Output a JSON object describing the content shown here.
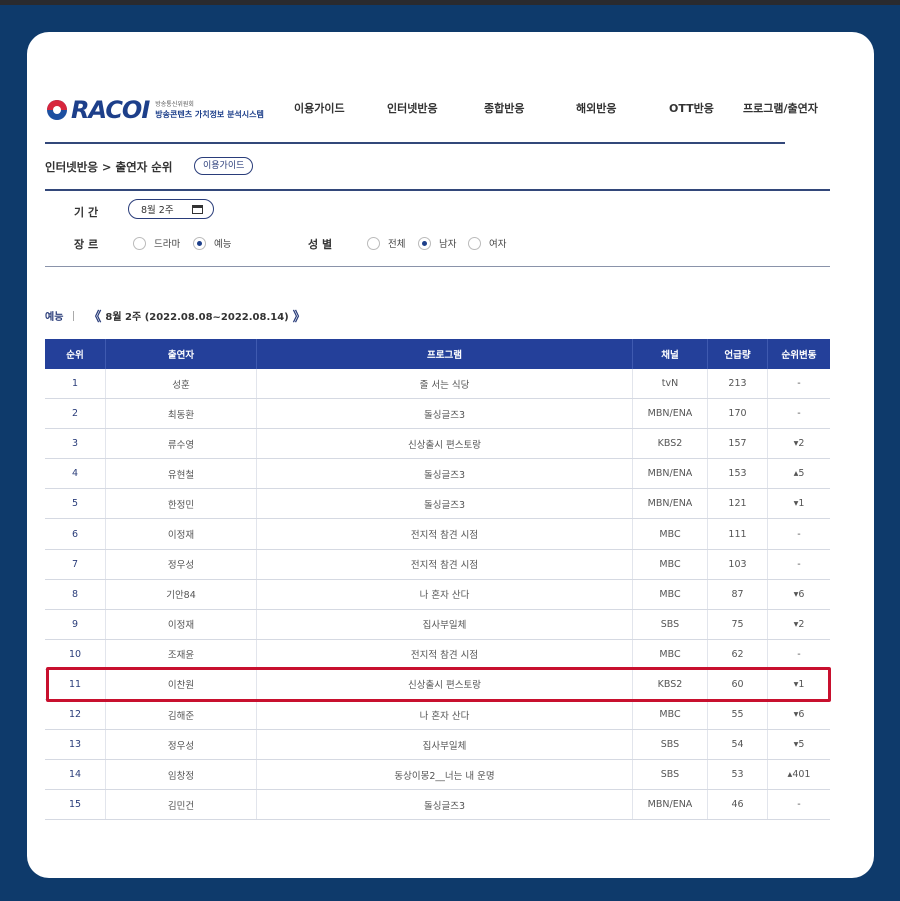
{
  "logo": {
    "word": "RACOI",
    "sub_top": "방송통신위원회",
    "sub_bottom": "방송콘텐츠 가치정보 분석시스템"
  },
  "nav": [
    "이용가이드",
    "인터넷반응",
    "종합반응",
    "해외반응",
    "OTT반응",
    "프로그램/출연자"
  ],
  "breadcrumb": "인터넷반응 > 출연자 순위",
  "guide_button": "이용가이드",
  "filters": {
    "period_label": "기 간",
    "period_value": "8월 2주",
    "genre_label": "장 르",
    "genre_options": [
      {
        "label": "드라마",
        "selected": false
      },
      {
        "label": "예능",
        "selected": true
      }
    ],
    "gender_label": "성 별",
    "gender_options": [
      {
        "label": "전체",
        "selected": false
      },
      {
        "label": "남자",
        "selected": true
      },
      {
        "label": "여자",
        "selected": false
      }
    ]
  },
  "week": {
    "category": "예능",
    "prev": "《",
    "label": "8월 2주 (2022.08.08~2022.08.14)",
    "next": "》"
  },
  "table": {
    "headers": [
      "순위",
      "출연자",
      "프로그램",
      "채널",
      "언급량",
      "순위변동"
    ],
    "rows": [
      [
        "1",
        "성훈",
        "줄 서는 식당",
        "tvN",
        "213",
        "-"
      ],
      [
        "2",
        "최동환",
        "돌싱글즈3",
        "MBN/ENA",
        "170",
        "-"
      ],
      [
        "3",
        "류수영",
        "신상출시 편스토랑",
        "KBS2",
        "157",
        "▾2"
      ],
      [
        "4",
        "유현철",
        "돌싱글즈3",
        "MBN/ENA",
        "153",
        "▴5"
      ],
      [
        "5",
        "한정민",
        "돌싱글즈3",
        "MBN/ENA",
        "121",
        "▾1"
      ],
      [
        "6",
        "이정재",
        "전지적 참견 시점",
        "MBC",
        "111",
        "-"
      ],
      [
        "7",
        "정우성",
        "전지적 참견 시점",
        "MBC",
        "103",
        "-"
      ],
      [
        "8",
        "기안84",
        "나 혼자 산다",
        "MBC",
        "87",
        "▾6"
      ],
      [
        "9",
        "이정재",
        "집사부일체",
        "SBS",
        "75",
        "▾2"
      ],
      [
        "10",
        "조재윤",
        "전지적 참견 시점",
        "MBC",
        "62",
        "-"
      ],
      [
        "11",
        "이찬원",
        "신상출시 편스토랑",
        "KBS2",
        "60",
        "▾1"
      ],
      [
        "12",
        "김해준",
        "나 혼자 산다",
        "MBC",
        "55",
        "▾6"
      ],
      [
        "13",
        "정우성",
        "집사부일체",
        "SBS",
        "54",
        "▾5"
      ],
      [
        "14",
        "임창정",
        "동상이몽2__너는 내 운명",
        "SBS",
        "53",
        "▴401"
      ],
      [
        "15",
        "김민건",
        "돌싱글즈3",
        "MBN/ENA",
        "46",
        "-"
      ]
    ]
  },
  "colors": {
    "header_bg": "#24409a",
    "highlight": "#c8102e",
    "page_bg": "#0e3a6b"
  }
}
